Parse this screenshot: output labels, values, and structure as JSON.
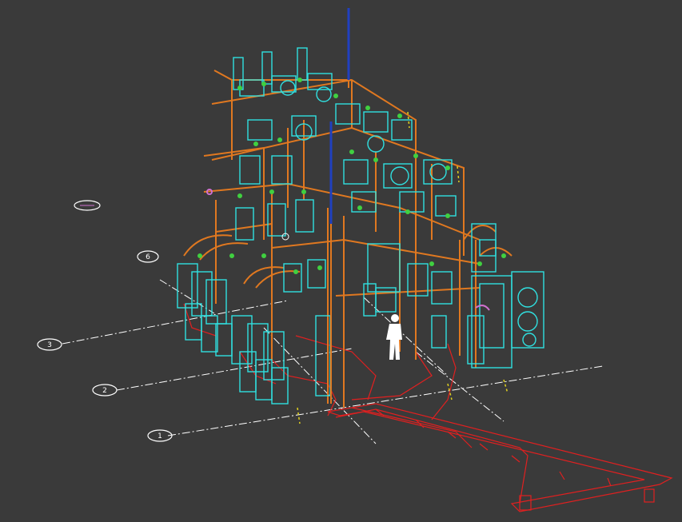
{
  "viewport": {
    "background": "#3a3a3a"
  },
  "colors": {
    "steel": "#e07820",
    "equipment": "#30e0e0",
    "cable_tray": "#e02020",
    "insulator": "#40d040",
    "lightning_rod": "#2040c0",
    "grid_line": "#ffffff",
    "person": "#ffffff",
    "marker": "#e0d020",
    "magenta": "#d070d0"
  },
  "grid_bubbles": [
    {
      "label": "6"
    },
    {
      "label": "3"
    },
    {
      "label": "2"
    },
    {
      "label": "1"
    }
  ],
  "annotation_bubble": {
    "label": ""
  }
}
